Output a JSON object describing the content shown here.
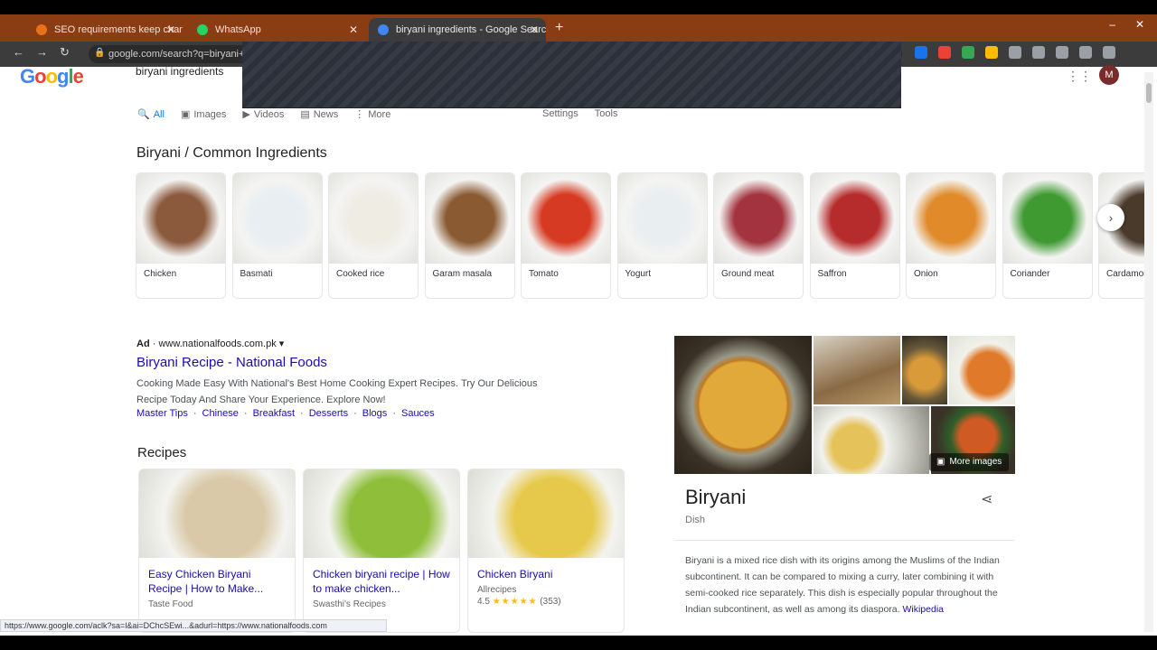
{
  "browser": {
    "tabs": [
      {
        "title": "SEO requirements keep changing",
        "active": false,
        "favicon_color": "#e8711a"
      },
      {
        "title": "WhatsApp",
        "active": false,
        "favicon_color": "#25d366"
      },
      {
        "title": "biryani ingredients - Google Search",
        "active": true,
        "favicon_color": "#4285f4"
      }
    ],
    "new_tab_icon": "plus-icon",
    "address": "google.com/search?q=biryani+ingredients",
    "extension_colors": [
      "#1a73e8",
      "#ea4335",
      "#34a853",
      "#fbbc05",
      "#9aa0a6",
      "#9aa0a6",
      "#9aa0a6",
      "#9aa0a6",
      "#9aa0a6"
    ]
  },
  "google": {
    "logo_letters": [
      "G",
      "o",
      "o",
      "g",
      "l",
      "e"
    ],
    "query": "biryani ingredients",
    "avatar_initial": "M",
    "tabs": [
      {
        "label": "All",
        "icon": "search-icon",
        "active": true
      },
      {
        "label": "Images",
        "icon": "image-icon",
        "active": false
      },
      {
        "label": "Videos",
        "icon": "video-icon",
        "active": false
      },
      {
        "label": "News",
        "icon": "news-icon",
        "active": false
      },
      {
        "label": "More",
        "icon": "more-icon",
        "active": false
      }
    ],
    "tools": [
      "Settings",
      "Tools"
    ]
  },
  "ingredients": {
    "heading": "Biryani / Common Ingredients",
    "items": [
      {
        "label": "Chicken",
        "color": "#8b5a3c"
      },
      {
        "label": "Basmati",
        "color": "#e8eef2"
      },
      {
        "label": "Cooked rice",
        "color": "#efece4"
      },
      {
        "label": "Garam masala",
        "color": "#8a5a32"
      },
      {
        "label": "Tomato",
        "color": "#d63a22"
      },
      {
        "label": "Yogurt",
        "color": "#e9eef0"
      },
      {
        "label": "Ground meat",
        "color": "#a3333e"
      },
      {
        "label": "Saffron",
        "color": "#b62b2b"
      },
      {
        "label": "Onion",
        "color": "#e08a2a"
      },
      {
        "label": "Coriander",
        "color": "#3f9a32"
      },
      {
        "label": "Cardamom",
        "color": "#4a3a2c"
      }
    ]
  },
  "ad": {
    "label": "Ad",
    "url": "www.nationalfoods.com.pk",
    "title": "Biryani Recipe - National Foods",
    "description": "Cooking Made Easy With National's Best Home Cooking Expert Recipes. Try Our Delicious Recipe Today And Share Your Experience. Explore Now!",
    "links": [
      "Master Tips",
      "Chinese",
      "Breakfast",
      "Desserts",
      "Blogs",
      "Sauces"
    ]
  },
  "recipes": {
    "heading": "Recipes",
    "items": [
      {
        "title": "Easy Chicken Biryani Recipe | How to Make...",
        "source": "Taste Food",
        "rating": "",
        "stars": "",
        "color": "#d9c9a8"
      },
      {
        "title": "Chicken biryani recipe | How to make chicken...",
        "source": "Swasthi's Recipes",
        "rating": "",
        "stars": "",
        "color": "#8fbf3a"
      },
      {
        "title": "Chicken Biryani",
        "source": "Allrecipes",
        "rating": "4.5",
        "stars": "★★★★★",
        "count": "(353)",
        "color": "#e6c94a"
      }
    ]
  },
  "knowledge_panel": {
    "title": "Biryani",
    "subtitle": "Dish",
    "more_images": "More images",
    "description": "Biryani is a mixed rice dish with its origins among the Muslims of the Indian subcontinent. It can be compared to mixing a curry, later combining it with semi-cooked rice separately. This dish is especially popular throughout the Indian subcontinent, as well as among its diaspora.",
    "source": "Wikipedia"
  },
  "status_bar": "https://www.google.com/aclk?sa=l&ai=DChcSEwi...&adurl=https://www.nationalfoods.com"
}
